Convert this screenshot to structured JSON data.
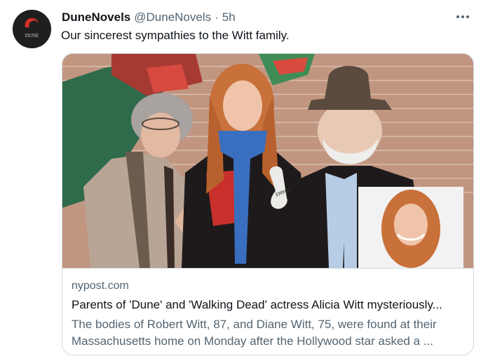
{
  "tweet": {
    "author_name": "DuneNovels",
    "author_handle": "@DuneNovels",
    "separator": "·",
    "time": "5h",
    "text": "Our sincerest sympathies to the Witt family.",
    "avatar_text": "DUNE",
    "more_icon": "more-horizontal-icon"
  },
  "card": {
    "domain": "nypost.com",
    "title": "Parents of 'Dune' and 'Walking Dead' actress Alicia Witt mysteriously...",
    "description_line1": "The bodies of Robert Witt, 87, and Diane Witt, 75, were found at their",
    "description_line2": "Massachusetts home on Monday after the Hollywood star asked a ...",
    "name_tag": "EMMA"
  },
  "colors": {
    "text_primary": "#0f1419",
    "text_secondary": "#536471",
    "border": "#cfd9de",
    "avatar_bg": "#1f1f1f",
    "avatar_logo": "#d9302a",
    "scarf": "#3a6fc0",
    "hair": "#c8713a"
  }
}
